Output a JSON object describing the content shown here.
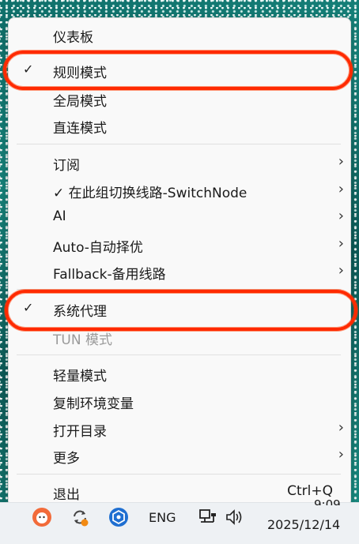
{
  "menu": {
    "items": [
      {
        "label": "仪表板"
      },
      {
        "label": "规则模式",
        "checked": true
      },
      {
        "label": "全局模式"
      },
      {
        "label": "直连模式"
      },
      {
        "label": "订阅"
      },
      {
        "label": "✓ 在此组切换线路-SwitchNode"
      },
      {
        "label": "AI"
      },
      {
        "label": "Auto-自动择优"
      },
      {
        "label": "Fallback-备用线路"
      },
      {
        "label": "系统代理",
        "checked": true
      },
      {
        "label": "TUN 模式",
        "disabled": true
      },
      {
        "label": "轻量模式"
      },
      {
        "label": "复制环境变量"
      },
      {
        "label": "打开目录"
      },
      {
        "label": "更多"
      },
      {
        "label": "退出",
        "shortcut": "Ctrl+Q"
      }
    ],
    "check_glyph": "✓",
    "chevron_glyph": "›"
  },
  "taskbar": {
    "lang": "ENG",
    "time": "9:09",
    "date": "2025/12/14"
  },
  "colors": {
    "annotation": "#ff2a00",
    "menu_bg": "#f9f9f9"
  }
}
